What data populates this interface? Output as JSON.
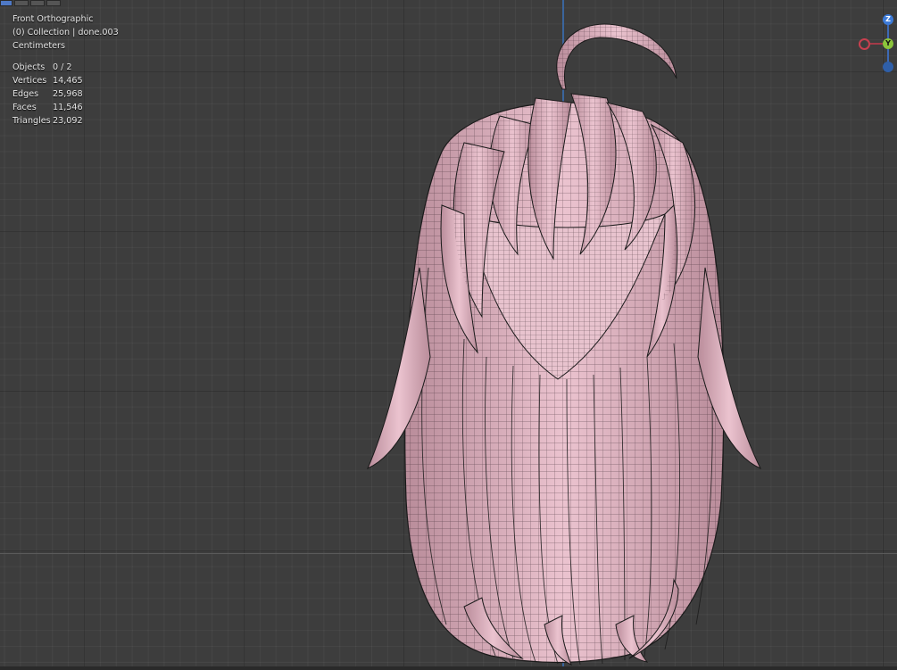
{
  "header": {
    "tabs": [
      "",
      "",
      "",
      ""
    ]
  },
  "viewport": {
    "view_name": "Front Orthographic",
    "collection": "(0) Collection | done.003",
    "units": "Centimeters",
    "stats": [
      {
        "label": "Objects",
        "value": "0 / 2"
      },
      {
        "label": "Vertices",
        "value": "14,465"
      },
      {
        "label": "Edges",
        "value": "25,968"
      },
      {
        "label": "Faces",
        "value": "11,546"
      },
      {
        "label": "Triangles",
        "value": "23,092"
      }
    ]
  },
  "gizmo": {
    "z_label": "Z",
    "y_label": "Y",
    "x_color": "#c8404f",
    "y_color": "#8cc43c",
    "z_color": "#3d7bd8"
  },
  "colors": {
    "mesh_fill": "#e3b9c6",
    "wire": "#1a1a1a",
    "grid_bg": "#3d3d3d",
    "z_axis": "#3b6aa8"
  }
}
